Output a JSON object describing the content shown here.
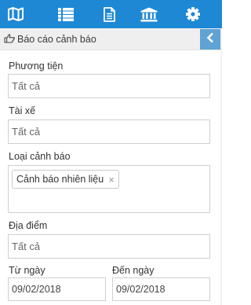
{
  "nav": {
    "items": [
      {
        "name": "map-nav-button",
        "icon": "map-icon"
      },
      {
        "name": "list-nav-button",
        "icon": "list-icon"
      },
      {
        "name": "document-nav-button",
        "icon": "document-icon"
      },
      {
        "name": "bank-nav-button",
        "icon": "bank-icon"
      },
      {
        "name": "settings-nav-button",
        "icon": "gear-icon"
      }
    ]
  },
  "panel": {
    "title": "Báo cáo cảnh báo",
    "title_icon": "hand-pointer-icon",
    "collapse_icon": "chevron-left-icon"
  },
  "form": {
    "vehicle": {
      "label": "Phương tiện",
      "value": "Tất cả"
    },
    "driver": {
      "label": "Tài xế",
      "value": "Tất cả"
    },
    "alert_type": {
      "label": "Loại cảnh báo",
      "selected": [
        "Cảnh báo nhiên liệu"
      ],
      "remove_symbol": "×"
    },
    "location": {
      "label": "Địa điểm",
      "value": "Tất cả"
    },
    "from_date": {
      "label": "Từ ngày",
      "value": "09/02/2018"
    },
    "to_date": {
      "label": "Đến ngày",
      "value": "09/02/2018"
    }
  },
  "colors": {
    "topbar": "#1e88d5",
    "titlebar": "#efefef",
    "collapse_button": "#5fa3d4",
    "border": "#cfcfcf"
  }
}
